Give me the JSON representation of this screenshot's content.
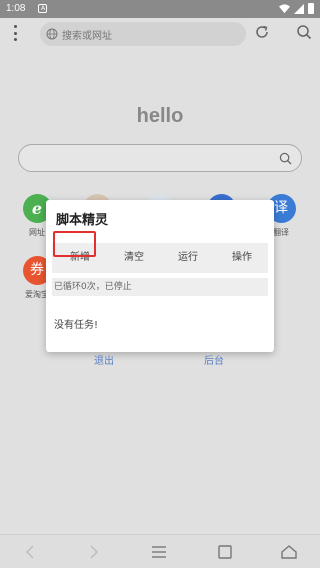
{
  "status_bar": {
    "time": "1:08",
    "notification_glyph": "A",
    "icons": [
      "wifi-icon",
      "signal-icon",
      "battery-icon"
    ]
  },
  "toolbar": {
    "search_placeholder": "搜索或网址",
    "icons": [
      "menu-dots-icon",
      "globe-icon",
      "refresh-icon",
      "search-icon"
    ]
  },
  "home": {
    "logo_text": "hello"
  },
  "shortcuts": [
    {
      "label": "网址",
      "glyph": "e",
      "color": "#4caf50"
    },
    {
      "label": "",
      "glyph": "",
      "color": "#d9c6b4"
    },
    {
      "label": "",
      "glyph": "",
      "color": "#5a8ad6"
    },
    {
      "label": "",
      "glyph": "",
      "color": "#3a6fd0"
    },
    {
      "label": "翻译",
      "glyph": "译",
      "color": "#3a7bd5"
    },
    {
      "label": "爱淘宝",
      "glyph": "券",
      "color": "#e8542f"
    }
  ],
  "dialog": {
    "title": "脚本精灵",
    "buttons": {
      "new": "新增",
      "clear": "清空",
      "run": "运行",
      "operate": "操作"
    },
    "status_text": "已循环0次，已停止",
    "empty_text": "没有任务!",
    "exit_label": "退出",
    "background_label": "后台"
  },
  "colors": {
    "highlight": "#e03030",
    "link": "#5a7fc4"
  },
  "bottom_nav": [
    "back-icon",
    "forward-icon",
    "menu-icon",
    "tabs-icon",
    "home-icon"
  ]
}
